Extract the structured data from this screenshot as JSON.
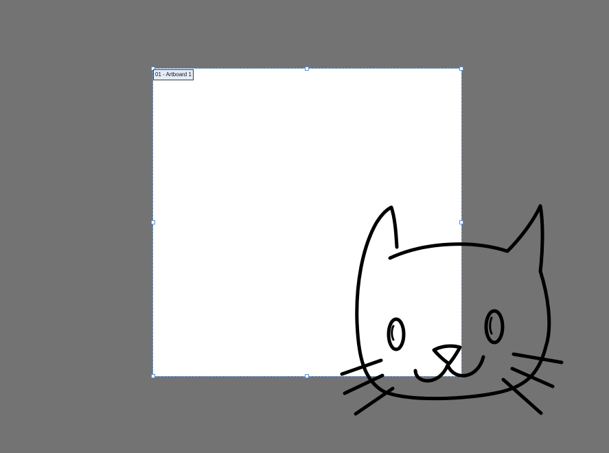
{
  "canvas": {
    "background": "#737373"
  },
  "artboard": {
    "label": "01 - Artboard 1",
    "fill": "#ffffff",
    "selection_color": "#6fa3e0"
  },
  "drawing": {
    "subject": "cat-face-line-drawing",
    "stroke_color": "#000000"
  }
}
